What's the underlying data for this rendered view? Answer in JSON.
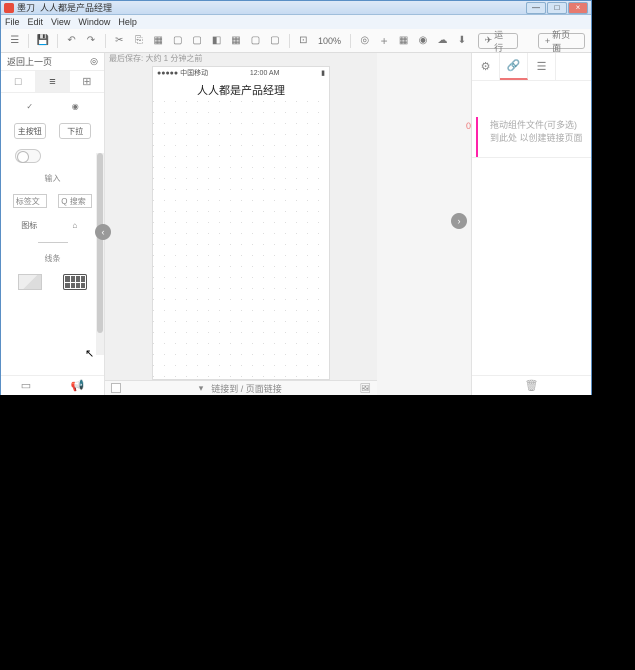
{
  "window": {
    "app_name": "墨刀",
    "doc_name": "人人都是产品经理",
    "min": "—",
    "max": "□",
    "close": "×"
  },
  "menu": [
    "File",
    "Edit",
    "View",
    "Window",
    "Help"
  ],
  "toolbar": {
    "zoom": "100%",
    "run": "运行",
    "new": "新页面"
  },
  "left": {
    "back": "返回上一页",
    "tabs": [
      "□",
      "≡",
      "⊞"
    ],
    "btn1": "主按钮",
    "btn2": "下拉",
    "sect_input": "输入",
    "placeholder": "标签文",
    "search": "Q 搜索",
    "icon_label": "图标",
    "sect_line": "线条"
  },
  "mid": {
    "hint": "最后保存: 大约 1 分钟之前",
    "carrier": "●●●●● 中国移动",
    "time": "12:00 AM",
    "title": "人人都是产品经理",
    "foot_label": "链接到 / 页面链接",
    "prev": "‹",
    "next": "›"
  },
  "right": {
    "num": "0",
    "placeholder": "拖动组件文件(可多选)到此处\n以创建链接页面"
  },
  "icons": {
    "save": "💾",
    "undo": "↶",
    "redo": "↷",
    "copy": "⎘",
    "paste": "📋",
    "target": "◎",
    "plus": "+",
    "eye": "👁",
    "cloud": "☁",
    "download": "⬇",
    "rocket": "✈",
    "check": "✓",
    "radio": "◉",
    "home": "⌂",
    "gear": "⚙",
    "link": "🔗",
    "list": "☰",
    "trash": "🗑",
    "image": "🖼",
    "horn": "📢",
    "card": "▭",
    "chevdown": "▾"
  }
}
